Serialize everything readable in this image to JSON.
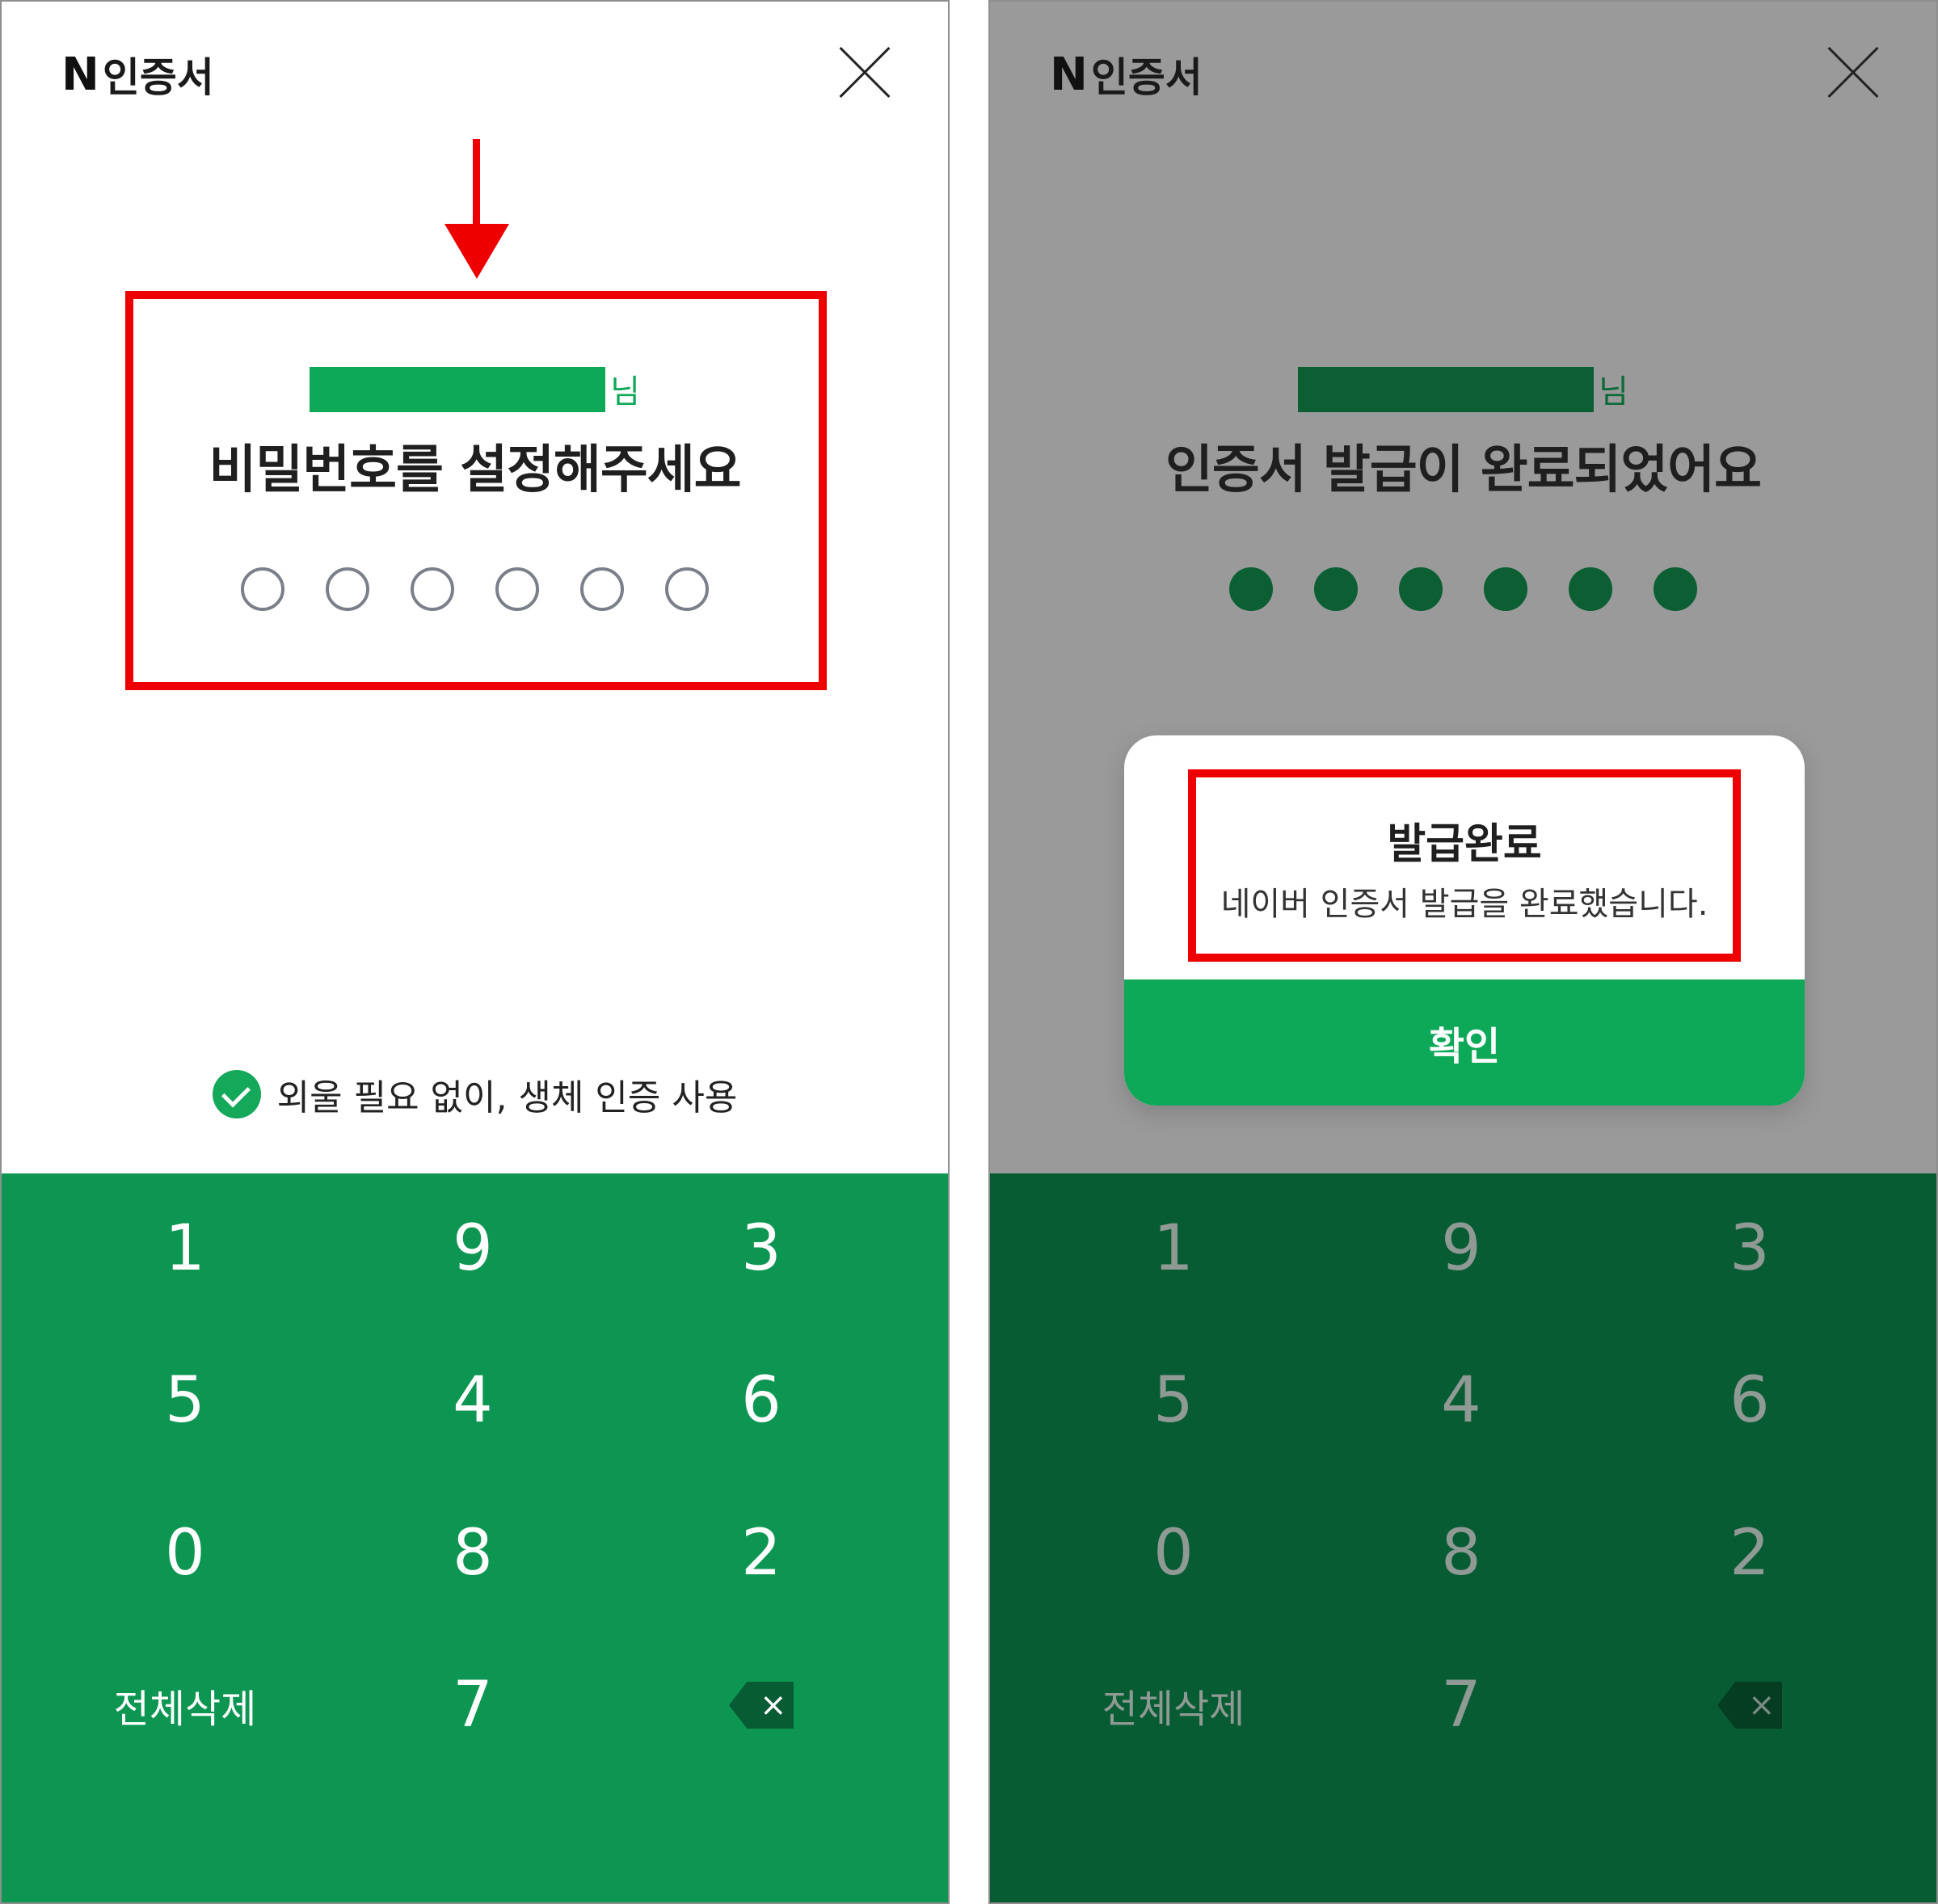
{
  "colors": {
    "accent_green": "#0ea859",
    "keypad_green": "#0d9652",
    "keypad_dim": "#075c34",
    "annotation_red": "#ee0000"
  },
  "left": {
    "brand_mark": "N",
    "brand_title": "인증서",
    "close_icon": "close-icon",
    "name_suffix": "님",
    "heading": "비밀번호를 설정해주세요",
    "pin_filled": 0,
    "biometric_label": "외울 필요 없이, 생체 인증 사용",
    "keys": [
      "1",
      "9",
      "3",
      "5",
      "4",
      "6",
      "0",
      "8",
      "2",
      "전체삭제",
      "7"
    ],
    "backspace_icon": "backspace-icon"
  },
  "right": {
    "brand_mark": "N",
    "brand_title": "인증서",
    "close_icon": "close-icon",
    "name_suffix": "님",
    "heading": "인증서 발급이 완료되었어요",
    "pin_filled": 6,
    "keys": [
      "1",
      "9",
      "3",
      "5",
      "4",
      "6",
      "0",
      "8",
      "2",
      "전체삭제",
      "7"
    ],
    "backspace_icon": "backspace-icon",
    "dialog": {
      "title": "발급완료",
      "message": "네이버 인증서 발급을 완료했습니다.",
      "confirm_label": "확인"
    }
  }
}
